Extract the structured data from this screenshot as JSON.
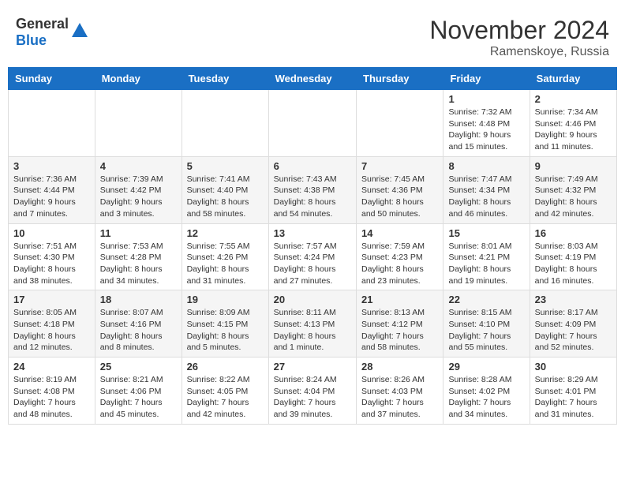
{
  "app": {
    "name_general": "General",
    "name_blue": "Blue"
  },
  "title": "November 2024",
  "location": "Ramenskoye, Russia",
  "days_of_week": [
    "Sunday",
    "Monday",
    "Tuesday",
    "Wednesday",
    "Thursday",
    "Friday",
    "Saturday"
  ],
  "weeks": [
    [
      {
        "day": "",
        "info": ""
      },
      {
        "day": "",
        "info": ""
      },
      {
        "day": "",
        "info": ""
      },
      {
        "day": "",
        "info": ""
      },
      {
        "day": "",
        "info": ""
      },
      {
        "day": "1",
        "info": "Sunrise: 7:32 AM\nSunset: 4:48 PM\nDaylight: 9 hours and 15 minutes."
      },
      {
        "day": "2",
        "info": "Sunrise: 7:34 AM\nSunset: 4:46 PM\nDaylight: 9 hours and 11 minutes."
      }
    ],
    [
      {
        "day": "3",
        "info": "Sunrise: 7:36 AM\nSunset: 4:44 PM\nDaylight: 9 hours and 7 minutes."
      },
      {
        "day": "4",
        "info": "Sunrise: 7:39 AM\nSunset: 4:42 PM\nDaylight: 9 hours and 3 minutes."
      },
      {
        "day": "5",
        "info": "Sunrise: 7:41 AM\nSunset: 4:40 PM\nDaylight: 8 hours and 58 minutes."
      },
      {
        "day": "6",
        "info": "Sunrise: 7:43 AM\nSunset: 4:38 PM\nDaylight: 8 hours and 54 minutes."
      },
      {
        "day": "7",
        "info": "Sunrise: 7:45 AM\nSunset: 4:36 PM\nDaylight: 8 hours and 50 minutes."
      },
      {
        "day": "8",
        "info": "Sunrise: 7:47 AM\nSunset: 4:34 PM\nDaylight: 8 hours and 46 minutes."
      },
      {
        "day": "9",
        "info": "Sunrise: 7:49 AM\nSunset: 4:32 PM\nDaylight: 8 hours and 42 minutes."
      }
    ],
    [
      {
        "day": "10",
        "info": "Sunrise: 7:51 AM\nSunset: 4:30 PM\nDaylight: 8 hours and 38 minutes."
      },
      {
        "day": "11",
        "info": "Sunrise: 7:53 AM\nSunset: 4:28 PM\nDaylight: 8 hours and 34 minutes."
      },
      {
        "day": "12",
        "info": "Sunrise: 7:55 AM\nSunset: 4:26 PM\nDaylight: 8 hours and 31 minutes."
      },
      {
        "day": "13",
        "info": "Sunrise: 7:57 AM\nSunset: 4:24 PM\nDaylight: 8 hours and 27 minutes."
      },
      {
        "day": "14",
        "info": "Sunrise: 7:59 AM\nSunset: 4:23 PM\nDaylight: 8 hours and 23 minutes."
      },
      {
        "day": "15",
        "info": "Sunrise: 8:01 AM\nSunset: 4:21 PM\nDaylight: 8 hours and 19 minutes."
      },
      {
        "day": "16",
        "info": "Sunrise: 8:03 AM\nSunset: 4:19 PM\nDaylight: 8 hours and 16 minutes."
      }
    ],
    [
      {
        "day": "17",
        "info": "Sunrise: 8:05 AM\nSunset: 4:18 PM\nDaylight: 8 hours and 12 minutes."
      },
      {
        "day": "18",
        "info": "Sunrise: 8:07 AM\nSunset: 4:16 PM\nDaylight: 8 hours and 8 minutes."
      },
      {
        "day": "19",
        "info": "Sunrise: 8:09 AM\nSunset: 4:15 PM\nDaylight: 8 hours and 5 minutes."
      },
      {
        "day": "20",
        "info": "Sunrise: 8:11 AM\nSunset: 4:13 PM\nDaylight: 8 hours and 1 minute."
      },
      {
        "day": "21",
        "info": "Sunrise: 8:13 AM\nSunset: 4:12 PM\nDaylight: 7 hours and 58 minutes."
      },
      {
        "day": "22",
        "info": "Sunrise: 8:15 AM\nSunset: 4:10 PM\nDaylight: 7 hours and 55 minutes."
      },
      {
        "day": "23",
        "info": "Sunrise: 8:17 AM\nSunset: 4:09 PM\nDaylight: 7 hours and 52 minutes."
      }
    ],
    [
      {
        "day": "24",
        "info": "Sunrise: 8:19 AM\nSunset: 4:08 PM\nDaylight: 7 hours and 48 minutes."
      },
      {
        "day": "25",
        "info": "Sunrise: 8:21 AM\nSunset: 4:06 PM\nDaylight: 7 hours and 45 minutes."
      },
      {
        "day": "26",
        "info": "Sunrise: 8:22 AM\nSunset: 4:05 PM\nDaylight: 7 hours and 42 minutes."
      },
      {
        "day": "27",
        "info": "Sunrise: 8:24 AM\nSunset: 4:04 PM\nDaylight: 7 hours and 39 minutes."
      },
      {
        "day": "28",
        "info": "Sunrise: 8:26 AM\nSunset: 4:03 PM\nDaylight: 7 hours and 37 minutes."
      },
      {
        "day": "29",
        "info": "Sunrise: 8:28 AM\nSunset: 4:02 PM\nDaylight: 7 hours and 34 minutes."
      },
      {
        "day": "30",
        "info": "Sunrise: 8:29 AM\nSunset: 4:01 PM\nDaylight: 7 hours and 31 minutes."
      }
    ]
  ]
}
